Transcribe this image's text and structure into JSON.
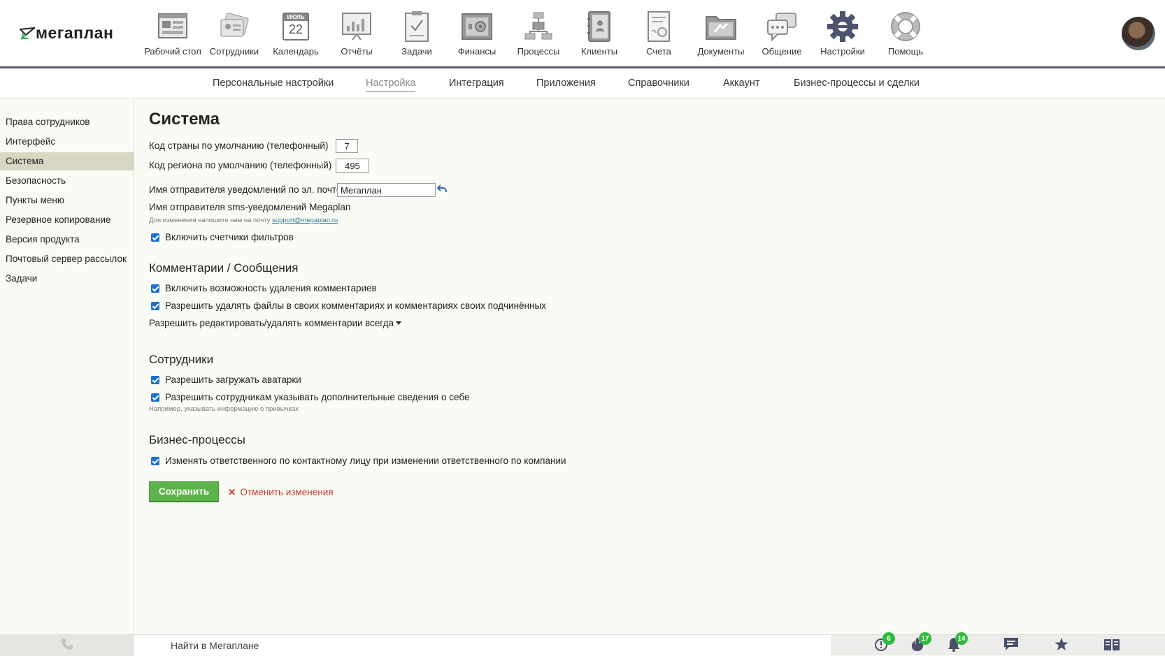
{
  "app": {
    "logo_text": "мегаплан"
  },
  "nav": [
    {
      "label": "Рабочий стол",
      "icon": "desktop-icon"
    },
    {
      "label": "Сотрудники",
      "icon": "employees-icon"
    },
    {
      "label": "Календарь",
      "icon": "calendar-icon",
      "month": "ИЮЛЬ",
      "day": "22"
    },
    {
      "label": "Отчёты",
      "icon": "reports-icon"
    },
    {
      "label": "Задачи",
      "icon": "tasks-icon"
    },
    {
      "label": "Финансы",
      "icon": "finance-icon"
    },
    {
      "label": "Процессы",
      "icon": "processes-icon"
    },
    {
      "label": "Клиенты",
      "icon": "clients-icon"
    },
    {
      "label": "Счета",
      "icon": "invoices-icon"
    },
    {
      "label": "Документы",
      "icon": "documents-icon"
    },
    {
      "label": "Общение",
      "icon": "chat-icon"
    },
    {
      "label": "Настройки",
      "icon": "settings-gear-icon",
      "active": true
    },
    {
      "label": "Помощь",
      "icon": "help-lifebuoy-icon"
    }
  ],
  "subnav": [
    {
      "label": "Персональные настройки"
    },
    {
      "label": "Настройка",
      "active": true
    },
    {
      "label": "Интеграция"
    },
    {
      "label": "Приложения"
    },
    {
      "label": "Справочники"
    },
    {
      "label": "Аккаунт"
    },
    {
      "label": "Бизнес-процессы и сделки"
    }
  ],
  "sidebar": [
    {
      "label": "Права сотрудников"
    },
    {
      "label": "Интерфейс"
    },
    {
      "label": "Система",
      "active": true
    },
    {
      "label": "Безопасность"
    },
    {
      "label": "Пункты меню"
    },
    {
      "label": "Резервное копирование"
    },
    {
      "label": "Версия продукта"
    },
    {
      "label": "Почтовый сервер рассылок"
    },
    {
      "label": "Задачи"
    }
  ],
  "main": {
    "title": "Система",
    "country_code": {
      "label": "Код страны по умолчанию (телефонный)",
      "value": "7"
    },
    "region_code": {
      "label": "Код региона по умолчанию (телефонный)",
      "value": "495"
    },
    "email_sender": {
      "label": "Имя отправителя уведомлений по эл. почте",
      "value": "Мегаплан"
    },
    "sms_sender": {
      "label": "Имя отправителя sms-уведомлений Megaplan"
    },
    "sms_hint": {
      "text": "Для изменения напишите нам на почту",
      "email": "support@megaplan.ru"
    },
    "filter_counters": {
      "label": "Включить счетчики фильтров",
      "checked": true
    },
    "comments": {
      "title": "Комментарии / Сообщения",
      "allow_delete": {
        "label": "Включить возможность удаления комментариев",
        "checked": true
      },
      "allow_delete_files": {
        "label": "Разрешить удалять файлы в своих комментариях и комментариях своих подчинённых",
        "checked": true
      },
      "edit_label": "Разрешить редактировать/удалять комментарии",
      "edit_value": "всегда"
    },
    "employees": {
      "title": "Сотрудники",
      "allow_avatars": {
        "label": "Разрешить загружать аватарки",
        "checked": true
      },
      "allow_info": {
        "label": "Разрешить сотрудникам указывать дополнительные сведения о себе",
        "checked": true
      },
      "info_hint": "Например, указывать информацию о привычках"
    },
    "bp": {
      "title": "Бизнес-процессы",
      "change_responsible": {
        "label": "Изменять ответственного по контактному лицу при изменении ответственного по компании",
        "checked": true
      }
    },
    "save_label": "Сохранить",
    "cancel_label": "Отменить изменения"
  },
  "bottom": {
    "search_text": "Найти в Мегаплане",
    "badges": {
      "alerts": "6",
      "hot": "17",
      "notifications": "14"
    }
  },
  "colors": {
    "accent_green": "#5cb34a",
    "checkbox_blue": "#1a6fd1",
    "badge_green": "#2dbb3c",
    "cancel_red": "#c0392b"
  }
}
